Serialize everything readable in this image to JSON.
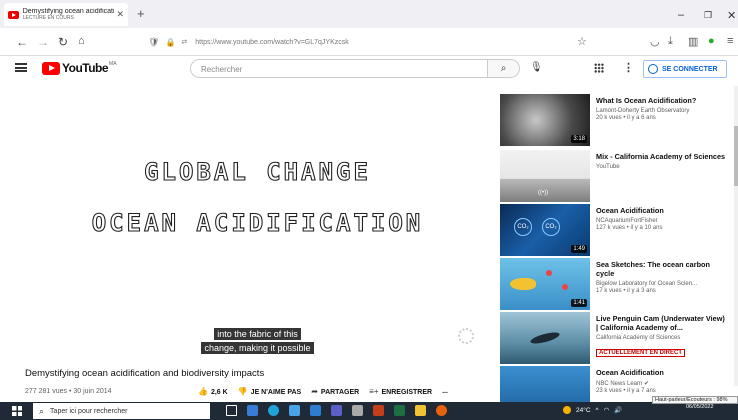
{
  "browser": {
    "tab": {
      "title": "Demystifying ocean acidificatio",
      "subtitle": "LECTURE EN COURS"
    },
    "url": "https://www.youtube.com/watch?v=GL7qJYKzcsk"
  },
  "youtube": {
    "logo_text": "YouTube",
    "logo_region": "MA",
    "search_placeholder": "Rechercher",
    "signin_label": "SE CONNECTER"
  },
  "video": {
    "overlay_line1": "GLOBAL CHANGE",
    "overlay_line2": "OCEAN ACIDIFICATION",
    "caption_line1": "into the fabric of this",
    "caption_line2": "change, making it possible",
    "title": "Demystifying ocean acidification and biodiversity impacts",
    "meta": "277 281 vues • 30 juin 2014",
    "actions": {
      "likes": "2,6 K",
      "dislike": "JE N'AIME PAS",
      "share": "PARTAGER",
      "save": "ENREGISTRER",
      "more": "..."
    }
  },
  "recommendations": [
    {
      "title": "What Is Ocean Acidification?",
      "channel": "Lamont-Doherty Earth Observatory",
      "views": "20 k vues • il y a 6 ans",
      "duration": "3:18",
      "live": ""
    },
    {
      "title": "Mix - California Academy of Sciences",
      "channel": "YouTube",
      "views": "",
      "duration": "",
      "live": ""
    },
    {
      "title": "Ocean Acidification",
      "channel": "NCAquariumFortFisher",
      "views": "127 k vues • il y a 10 ans",
      "duration": "1:49",
      "live": ""
    },
    {
      "title": "Sea Sketches: The ocean carbon cycle",
      "channel": "Bigelow Laboratory for Ocean Scien...",
      "views": "17 k vues • il y a 3 ans",
      "duration": "1:41",
      "live": ""
    },
    {
      "title": "Live Penguin Cam (Underwater View) | California Academy of...",
      "channel": "California Academy of Sciences",
      "views": "",
      "duration": "",
      "live": "ACTUELLEMENT EN DIRECT"
    },
    {
      "title": "Ocean Acidification",
      "channel": "NBC News Learn",
      "views": "23 k vues • il y a 7 ans",
      "duration": "",
      "live": ""
    }
  ],
  "taskbar": {
    "search_placeholder": "Taper ici pour rechercher",
    "weather": "24°C",
    "time": "",
    "date": "06/05/2022",
    "tooltip": "Haut-parleur/Écouteurs : 98%"
  }
}
